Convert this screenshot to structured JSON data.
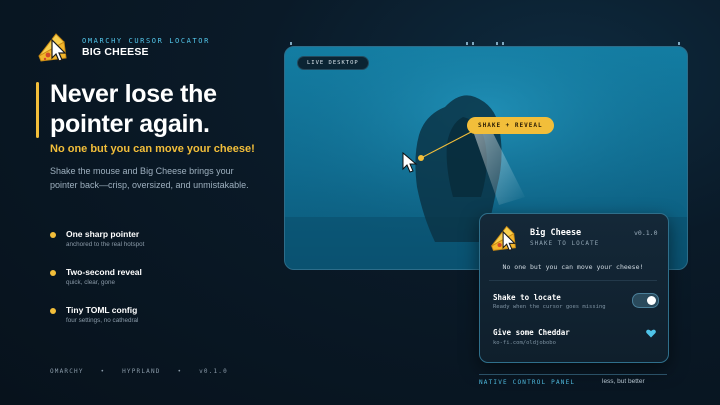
{
  "brand": {
    "kicker": "OMARCHY CURSOR LOCATOR",
    "name": "BIG CHEESE"
  },
  "hero": {
    "title_line1": "Never lose the",
    "title_line2": "pointer again.",
    "tagline": "No one but you can move your cheese!",
    "description": "Shake the mouse and Big Cheese brings your pointer back—crisp, oversized, and unmistakable."
  },
  "features": [
    {
      "title": "One sharp pointer",
      "subtitle": "anchored to the real hotspot"
    },
    {
      "title": "Two-second reveal",
      "subtitle": "quick, clear, gone"
    },
    {
      "title": "Tiny TOML config",
      "subtitle": "four settings, no cathedral"
    }
  ],
  "footer": {
    "items": [
      "OMARCHY",
      "•",
      "HYPRLAND",
      "•",
      "v0.1.0"
    ]
  },
  "desktop": {
    "live_label": "LIVE DESKTOP",
    "shake_label": "SHAKE + REVEAL"
  },
  "panel": {
    "title": "Big Cheese",
    "subtitle": "SHAKE TO LOCATE",
    "version": "v0.1.0",
    "tagline": "No one but you can move your cheese!",
    "shake_title": "Shake to locate",
    "shake_sub": "Ready when the cursor goes missing",
    "shake_enabled": true,
    "cheddar_title": "Give some Cheddar",
    "cheddar_sub": "ko-fi.com/oldjobobo"
  },
  "bottom": {
    "native_label": "NATIVE CONTROL PANEL",
    "right_tagline": "less, but better"
  },
  "colors": {
    "accent": "#f2be3a",
    "cyan": "#53c6ea",
    "heart": "#4fc3e8"
  }
}
